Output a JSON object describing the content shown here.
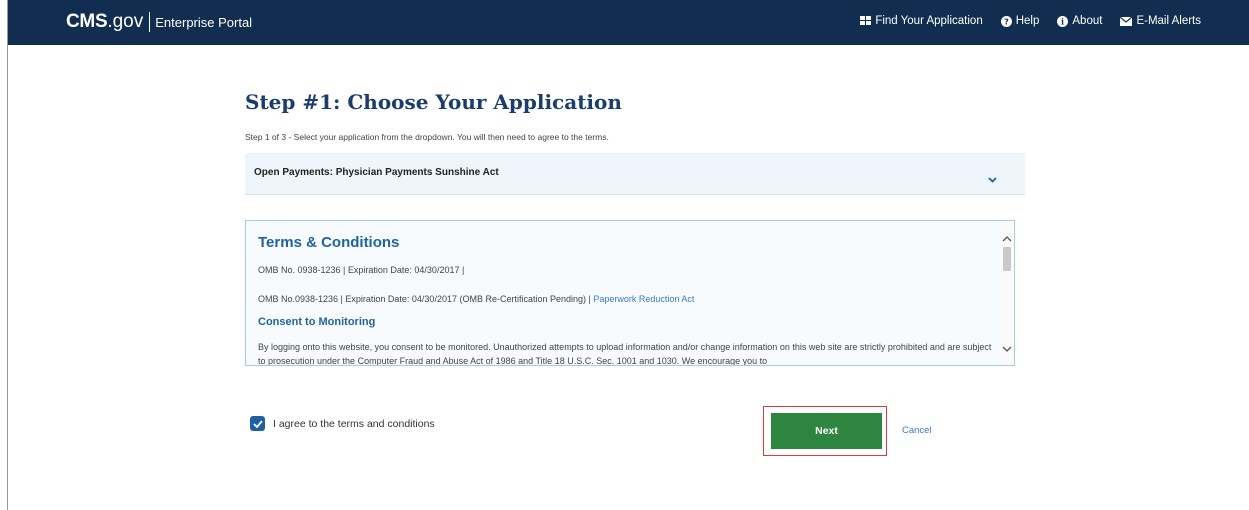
{
  "header": {
    "brand_cms": "CMS",
    "brand_gov": ".gov",
    "brand_portal": "Enterprise Portal",
    "nav": [
      {
        "label": "Find Your Application",
        "icon": "grid-icon"
      },
      {
        "label": "Help",
        "icon": "question-circle-icon"
      },
      {
        "label": "About",
        "icon": "info-circle-icon"
      },
      {
        "label": "E-Mail Alerts",
        "icon": "envelope-icon"
      }
    ]
  },
  "step": {
    "title": "Step #1: Choose Your Application",
    "subtitle": "Step 1 of 3 - Select your application from the dropdown. You will then need to agree to the terms."
  },
  "dropdown": {
    "selected": "Open Payments: Physician Payments Sunshine Act"
  },
  "terms": {
    "title": "Terms & Conditions",
    "line1": "OMB No. 0938-1236 | Expiration Date: 04/30/2017 |",
    "line2_text": "OMB No.0938-1236 | Expiration Date: 04/30/2017 (OMB Re-Certification Pending) | ",
    "line2_link": "Paperwork Reduction Act",
    "consent_title": "Consent to Monitoring",
    "consent_body": "By logging onto this website, you consent to be monitored. Unauthorized attempts to upload information and/or change information on this web site are strictly prohibited and are subject to prosecution under the Computer Fraud and Abuse Act of 1986 and Title 18 U.S.C. Sec. 1001 and 1030. We encourage you to"
  },
  "agree": {
    "label": "I agree to the terms and conditions",
    "checked": true
  },
  "actions": {
    "next_label": "Next",
    "cancel_label": "Cancel"
  },
  "colors": {
    "header_bg": "#112e51",
    "title": "#1a3d6e",
    "next_bg": "#2e8540",
    "highlight_border": "#e03a3a",
    "link": "#3a7bd5"
  }
}
